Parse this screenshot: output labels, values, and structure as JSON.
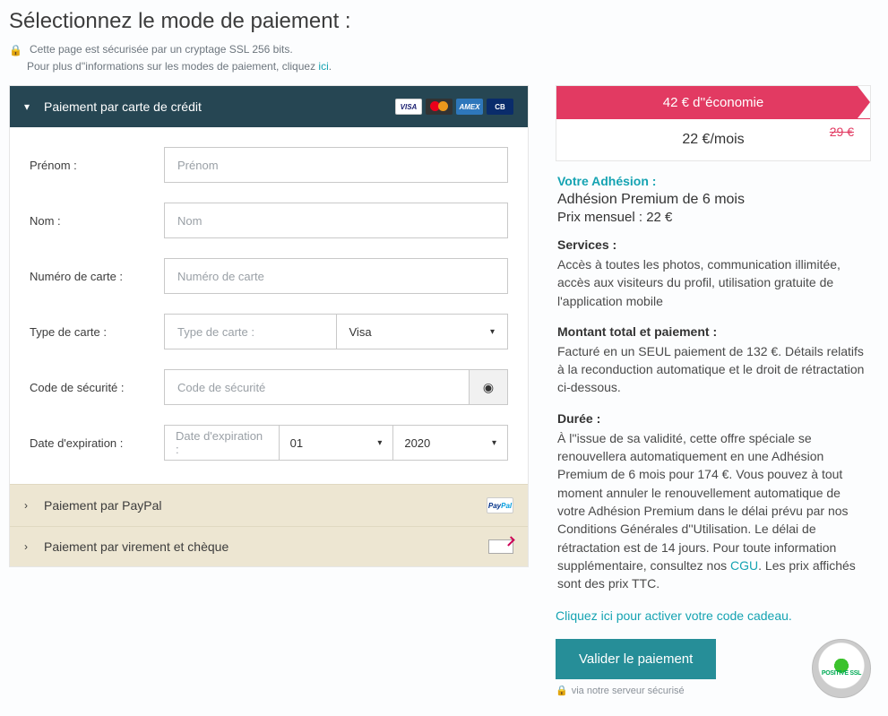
{
  "page_title": "Sélectionnez le mode de paiement :",
  "secure_text": "Cette page est sécurisée par un cryptage SSL 256 bits.",
  "more_info_prefix": "Pour plus d''informations sur les modes de paiement, cliquez ",
  "more_info_link": "ici",
  "more_info_suffix": ".",
  "accordion": {
    "credit_card": "Paiement par carte de crédit",
    "paypal": "Paiement par PayPal",
    "wire_cheque": "Paiement par virement et chèque"
  },
  "cc_form": {
    "firstname_label": "Prénom :",
    "firstname_ph": "Prénom",
    "lastname_label": "Nom :",
    "lastname_ph": "Nom",
    "cardnum_label": "Numéro de carte :",
    "cardnum_ph": "Numéro de carte",
    "cardtype_label": "Type de carte :",
    "cardtype_ph": "Type de carte :",
    "cardtype_value": "Visa",
    "seccode_label": "Code de sécurité :",
    "seccode_ph": "Code de sécurité",
    "expiry_label": "Date d'expiration :",
    "expiry_ph": "Date d'expiration :",
    "expiry_month": "01",
    "expiry_year": "2020"
  },
  "summary": {
    "savings": "42 € d''économie",
    "price_main": "22 €/mois",
    "price_old": "29 €",
    "adh_title": "Votre Adhésion :",
    "adh_name": "Adhésion Premium de 6 mois",
    "adh_price": "Prix mensuel : 22 €",
    "services_title": "Services :",
    "services_text": "Accès à toutes les photos, communication illimitée, accès aux visiteurs du profil, utilisation gratuite de l'application mobile",
    "total_title": "Montant total et paiement :",
    "total_text": "Facturé en un SEUL paiement de 132 €. Détails relatifs à la reconduction automatique et le droit de rétractation ci-dessous.",
    "duration_title": "Durée :",
    "duration_text_1": "À l''issue de sa validité, cette offre spéciale se renouvellera automatiquement en une Adhésion Premium de 6 mois pour 174 €. Vous pouvez à tout moment annuler le renouvellement automatique de votre Adhésion Premium dans le délai prévu par nos Conditions Générales d''Utilisation. Le délai de rétractation est de 14 jours. Pour toute information supplémentaire, consultez nos ",
    "duration_link": "CGU",
    "duration_text_2": ". Les prix affichés sont des prix TTC."
  },
  "promo_link": "Cliquez ici pour activer votre code cadeau.",
  "validate_btn": "Valider le paiement",
  "via_secure": "via notre serveur sécurisé",
  "ssl_label": "POSITIVE SSL"
}
